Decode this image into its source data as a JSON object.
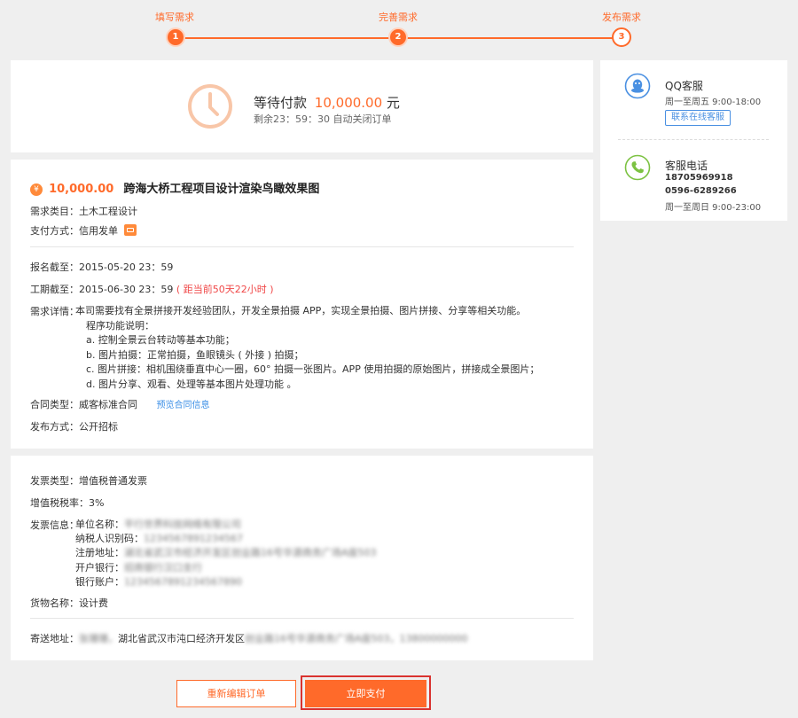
{
  "steps": {
    "items": [
      "填写需求",
      "完善需求",
      "发布需求"
    ],
    "numbers": [
      "1",
      "2",
      "3"
    ]
  },
  "payment": {
    "title_prefix": "等待付款",
    "amount": "10,000.00",
    "unit": "元",
    "countdown": "剩余23：59：30 自动关闭订单"
  },
  "order": {
    "currency_symbol": "¥",
    "price": "10,000.00",
    "title": "跨海大桥工程项目设计渲染鸟瞰效果图",
    "category": "需求类目：土木工程设计",
    "pay_method": "支付方式：信用发单",
    "signup_deadline": "报名截至：2015-05-20   23：59",
    "work_deadline": "工期截至：2015-06-30   23：59",
    "work_remaining": "( 距当前50天22小时 )",
    "detail_label": "需求详情：",
    "detail_lines": [
      "本司需要找有全景拼接开发经验团队，开发全景拍摄 APP，实现全景拍摄、图片拼接、分享等相关功能。",
      "程序功能说明：",
      "a. 控制全景云台转动等基本功能；",
      "b. 图片拍摄：正常拍摄，鱼眼镜头 ( 外接 ) 拍摄；",
      "c. 图片拼接：相机围绕垂直中心一圈，60° 拍摄一张图片。APP 使用拍摄的原始图片，拼接成全景图片；",
      "d. 图片分享、观看、处理等基本图片处理功能 。"
    ],
    "contract_type": "合同类型：威客标准合同",
    "contract_link": "预览合同信息",
    "publish_method": "发布方式：公开招标"
  },
  "invoice": {
    "type": "发票类型：增值税普通发票",
    "tax_rate": "增值税税率：3%",
    "info_label": "发票信息：",
    "info_lines": [
      {
        "label": "单位名称：",
        "value": "平行世界科技网络有限公司"
      },
      {
        "label": "纳税人识别码：",
        "value": "1234567891234567"
      },
      {
        "label": "注册地址：",
        "value": "湖北省武汉市经济开发区创业路16号华源商务广场A座503"
      },
      {
        "label": "开户银行：",
        "value": "招商银行汉口支行"
      },
      {
        "label": "银行账户：",
        "value": "1234567891234567890"
      }
    ],
    "goods": "货物名称：设计费",
    "address_label": "寄送地址：",
    "address_name": "张珊珊，",
    "address_clear": "湖北省武汉市沌口经济开发区",
    "address_blurred": "创业路16号华源商务广场A座503，13800000000"
  },
  "actions": {
    "edit_label": "重新编辑订单",
    "pay_label": "立即支付"
  },
  "service": {
    "qq_title": "QQ客服",
    "qq_hours": "周一至周五 9:00-18:00",
    "qq_button": "联系在线客服",
    "phone_title": "客服电话",
    "phone1": "18705969918",
    "phone2": "0596-6289266",
    "phone_hours": "周一至周日 9:00-23:00"
  },
  "colors": {
    "accent": "#ff6a2a",
    "link": "#3a8ee6",
    "warn": "#f04848"
  }
}
